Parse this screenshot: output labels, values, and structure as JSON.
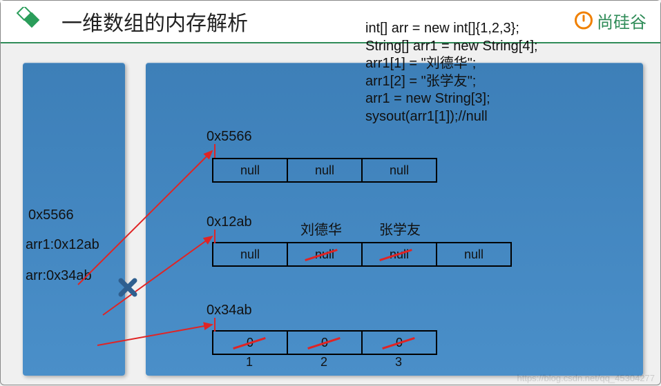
{
  "title": "一维数组的内存解析",
  "brand": "尚硅谷",
  "code_lines": "int[] arr = new int[]{1,2,3};\nString[] arr1 = new String[4];\narr1[1] = \"刘德华\";\narr1[2] = \"张学友\";\narr1 = new String[3];\nsysout(arr1[1]);//null",
  "stack": {
    "old_ref": "0x5566",
    "arr1_label": "arr1:0x12ab",
    "arr_label": "arr:0x34ab"
  },
  "heap": {
    "blockA": {
      "addr": "0x5566",
      "cells": [
        "null",
        "null",
        "null"
      ]
    },
    "blockB": {
      "addr": "0x12ab",
      "cells": [
        "null",
        "null",
        "null",
        "null"
      ],
      "overwrite": [
        "",
        "刘德华",
        "张学友",
        ""
      ]
    },
    "blockC": {
      "addr": "0x34ab",
      "cells": [
        "0",
        "0",
        "0"
      ],
      "indices": [
        "1",
        "2",
        "3"
      ]
    }
  },
  "watermark": "https://blog.csdn.net/qq_45304277"
}
